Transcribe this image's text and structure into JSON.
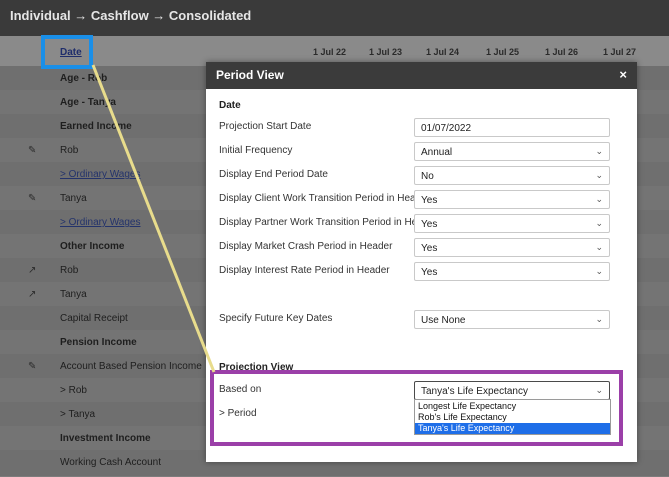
{
  "app": {
    "breadcrumb": "Individual → Cashflow → Consolidated",
    "date_header": "Date",
    "columns": [
      "1 Jul 22",
      "1 Jul 23",
      "1 Jul 24",
      "1 Jul 25",
      "1 Jul 26",
      "1 Jul 27"
    ],
    "rows": [
      {
        "label": "Age - Rob",
        "style": "bold",
        "icon": ""
      },
      {
        "label": "Age - Tanya",
        "style": "bold",
        "icon": ""
      },
      {
        "label": "Earned Income",
        "style": "bold",
        "icon": ""
      },
      {
        "label": "Rob",
        "style": "normal",
        "icon": "pencil-icon"
      },
      {
        "label": "> Ordinary Wages",
        "style": "link",
        "icon": ""
      },
      {
        "label": "Tanya",
        "style": "normal",
        "icon": "pencil-icon"
      },
      {
        "label": "> Ordinary Wages",
        "style": "link",
        "icon": ""
      },
      {
        "label": "Other Income",
        "style": "bold",
        "icon": ""
      },
      {
        "label": "Rob",
        "style": "normal",
        "icon": "expand-icon"
      },
      {
        "label": "Tanya",
        "style": "normal",
        "icon": "expand-icon"
      },
      {
        "label": "Capital Receipt",
        "style": "normal",
        "icon": ""
      },
      {
        "label": "Pension Income",
        "style": "bold",
        "icon": ""
      },
      {
        "label": "Account Based Pension Income",
        "style": "normal",
        "icon": "pencil-icon"
      },
      {
        "label": "> Rob",
        "style": "normal",
        "icon": ""
      },
      {
        "label": "> Tanya",
        "style": "normal",
        "icon": ""
      },
      {
        "label": "Investment Income",
        "style": "bold",
        "icon": ""
      },
      {
        "label": "Working Cash Account",
        "style": "normal",
        "icon": ""
      }
    ]
  },
  "modal": {
    "title": "Period View",
    "close": "×",
    "section_date": "Date",
    "fields": [
      {
        "label": "Projection Start Date",
        "value": "01/07/2022",
        "type": "text"
      },
      {
        "label": "Initial Frequency",
        "value": "Annual",
        "type": "select"
      },
      {
        "label": "Display End Period Date",
        "value": "No",
        "type": "select"
      },
      {
        "label": "Display Client Work Transition Period in Header",
        "value": "Yes",
        "type": "select"
      },
      {
        "label": "Display Partner Work Transition Period in Header",
        "value": "Yes",
        "type": "select"
      },
      {
        "label": "Display Market Crash Period in Header",
        "value": "Yes",
        "type": "select"
      },
      {
        "label": "Display Interest Rate Period in Header",
        "value": "Yes",
        "type": "select"
      }
    ],
    "future_dates": {
      "label": "Specify Future Key Dates",
      "value": "Use None"
    },
    "section_projection": "Projection View",
    "based_on": {
      "label": "Based on",
      "value": "Tanya's Life Expectancy",
      "options": [
        "Longest Life Expectancy",
        "Rob's Life Expectancy",
        "Tanya's Life Expectancy"
      ],
      "selected_index": 2
    },
    "period_label": "> Period"
  }
}
